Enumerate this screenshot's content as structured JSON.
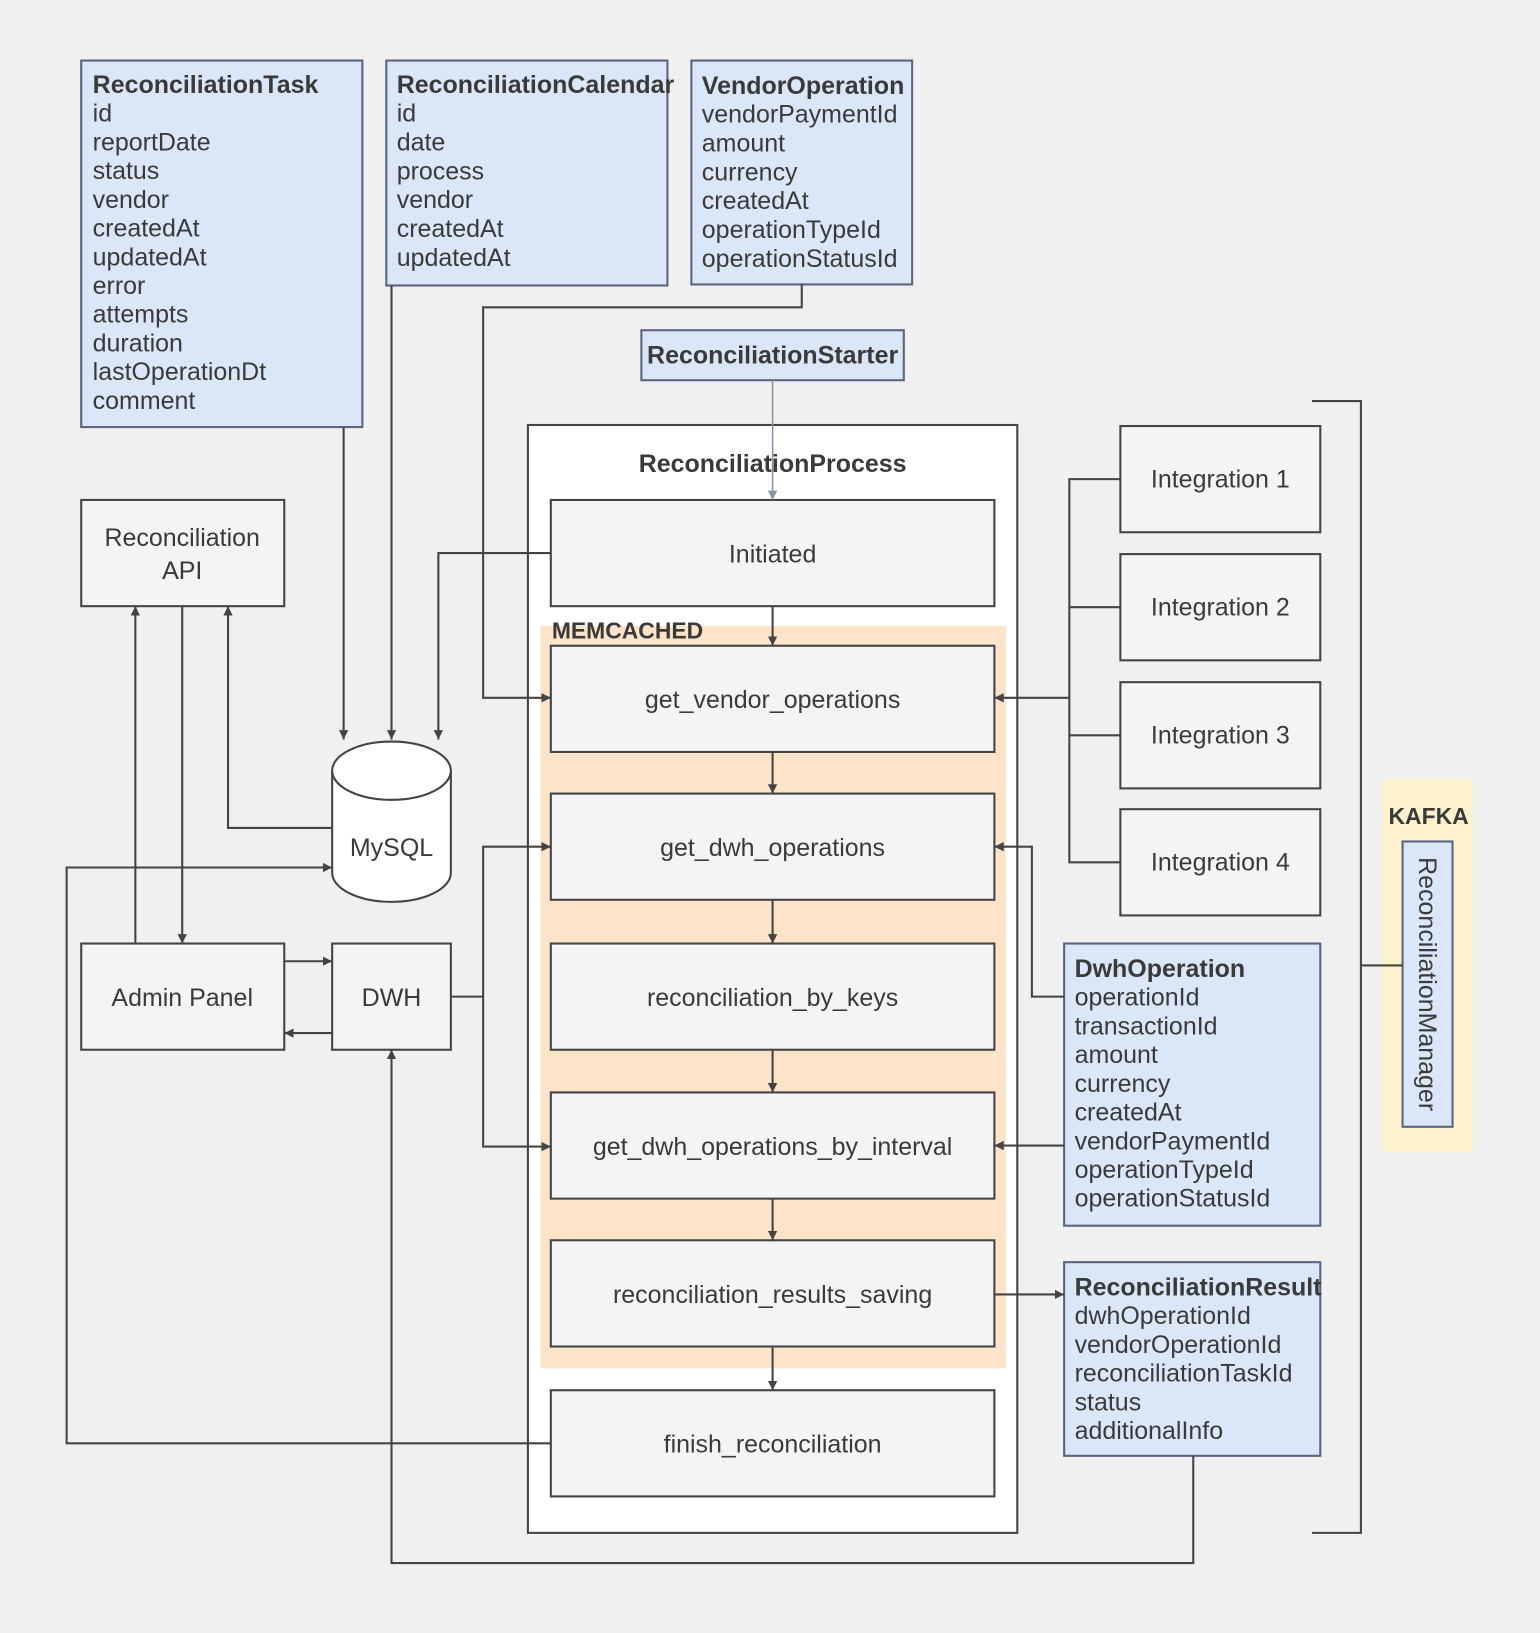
{
  "entities": {
    "task": {
      "title": "ReconciliationTask",
      "fields": [
        "id",
        "reportDate",
        "status",
        "vendor",
        "createdAt",
        "updatedAt",
        "error",
        "attempts",
        "duration",
        "lastOperationDt",
        "comment"
      ]
    },
    "calendar": {
      "title": "ReconciliationCalendar",
      "fields": [
        "id",
        "date",
        "process",
        "vendor",
        "createdAt",
        "updatedAt"
      ]
    },
    "vendor_operation": {
      "title": "VendorOperation",
      "fields": [
        "vendorPaymentId",
        "amount",
        "currency",
        "createdAt",
        "operationTypeId",
        "operationStatusId"
      ]
    },
    "dwh_operation": {
      "title": "DwhOperation",
      "fields": [
        "operationId",
        "transactionId",
        "amount",
        "currency",
        "createdAt",
        "vendorPaymentId",
        "operationTypeId",
        "operationStatusId"
      ]
    },
    "result": {
      "title": "ReconciliationResult",
      "fields": [
        "dwhOperationId",
        "vendorOperationId",
        "reconciliationTaskId",
        "status",
        "additionalInfo"
      ]
    }
  },
  "starter": "ReconciliationStarter",
  "process": {
    "title": "ReconciliationProcess",
    "memcached_label": "MEMCACHED",
    "steps": [
      "Initiated",
      "get_vendor_operations",
      "get_dwh_operations",
      "reconciliation_by_keys",
      "get_dwh_operations_by_interval",
      "reconciliation_results_saving",
      "finish_reconciliation"
    ]
  },
  "integrations": [
    "Integration 1",
    "Integration 2",
    "Integration 3",
    "Integration 4"
  ],
  "kafka": {
    "label": "KAFKA",
    "manager": "ReconciliationManager"
  },
  "api": {
    "line1": "Reconciliation",
    "line2": "API"
  },
  "admin_panel": "Admin Panel",
  "dwh": "DWH",
  "mysql": "MySQL",
  "colors": {
    "entity": "#dae7f8",
    "memcached": "#fde3c8",
    "kafka": "#fdf2cc",
    "starter_arrow": "#8a93a8"
  }
}
